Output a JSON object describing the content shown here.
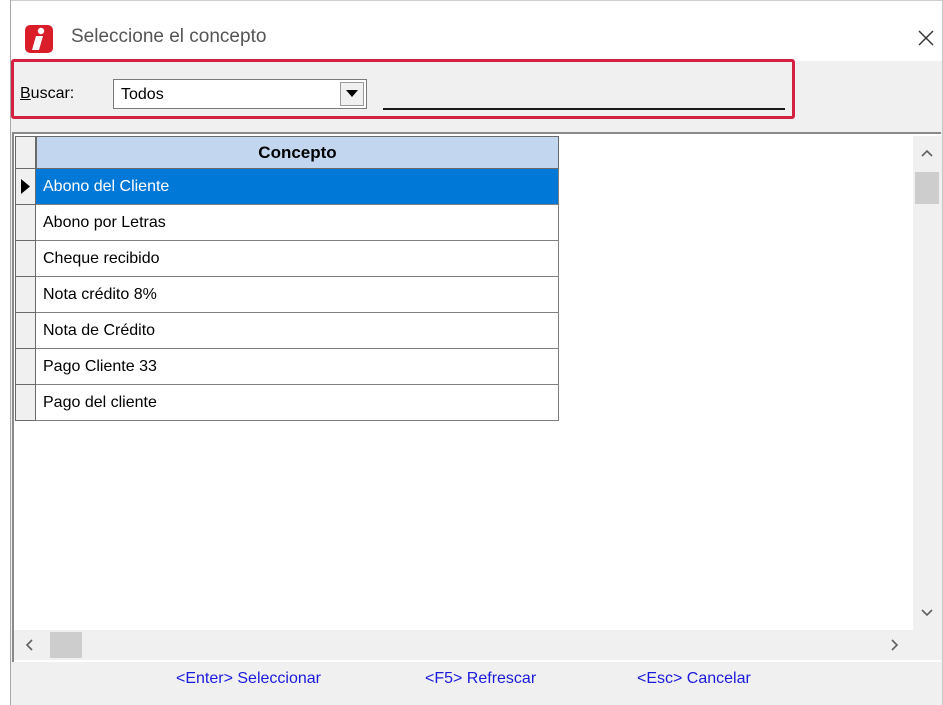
{
  "window": {
    "title": "Seleccione el concepto",
    "app_icon": "red-i-icon",
    "close_icon": "close-icon"
  },
  "search": {
    "label_accel": "B",
    "label_rest": "uscar:",
    "combo_value": "Todos",
    "combo_button_icon": "chevron-down-icon",
    "text_value": "",
    "highlight_color": "#d3213f"
  },
  "grid": {
    "column_header": "Concepto",
    "header_color": "#c3d6ef",
    "selection_color": "#0078d7",
    "selected_index": 0,
    "rows": [
      {
        "concepto": "Abono del Cliente"
      },
      {
        "concepto": "Abono por Letras"
      },
      {
        "concepto": "Cheque recibido"
      },
      {
        "concepto": "Nota crédito 8%"
      },
      {
        "concepto": "Nota de Crédito"
      },
      {
        "concepto": "Pago Cliente 33"
      },
      {
        "concepto": "Pago del cliente"
      }
    ]
  },
  "footer": {
    "select_label": "<Enter> Seleccionar",
    "refresh_label": "<F5> Refrescar",
    "cancel_label": "<Esc> Cancelar",
    "link_color": "#1a1adc"
  }
}
